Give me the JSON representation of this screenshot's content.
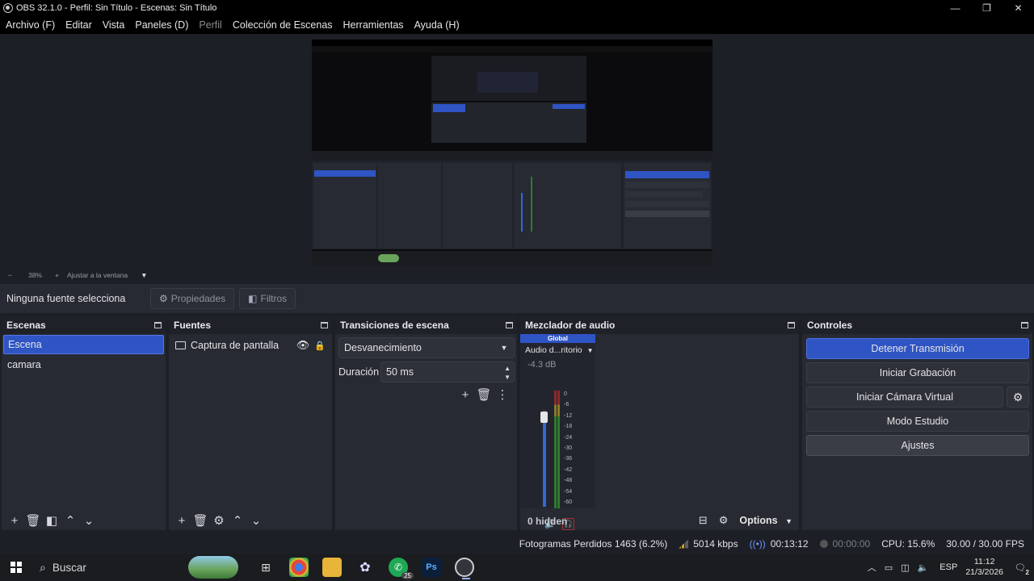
{
  "window": {
    "title": "OBS 32.1.0 - Perfil: Sin Título - Escenas: Sin Título",
    "minimize": "—",
    "maximize": "❐",
    "close": "✕"
  },
  "menu": [
    "Archivo (F)",
    "Editar",
    "Vista",
    "Paneles (D)",
    "Perfil",
    "Colección de Escenas",
    "Herramientas",
    "Ayuda (H)"
  ],
  "zoom": {
    "minus": "−",
    "value": "38%",
    "plus": "+",
    "fit": "Ajustar a la ventana",
    "dropdown": "▼"
  },
  "source_toolbar": {
    "no_selection": "Ninguna fuente selecciona",
    "properties": "Propiedades",
    "filters": "Filtros"
  },
  "scenes": {
    "title": "Escenas",
    "items": [
      "Escena",
      "camara"
    ]
  },
  "sources": {
    "title": "Fuentes",
    "items": [
      {
        "name": "Captura de pantalla",
        "icon": "monitor-icon"
      }
    ]
  },
  "transitions": {
    "title": "Transiciones de escena",
    "selected": "Desvanecimiento",
    "duration_label": "Duración",
    "duration_value": "50 ms"
  },
  "audio_mixer": {
    "title": "Mezclador de audio",
    "global_label": "Global",
    "channel_name": "Audio d...ritorio",
    "db": "-4.3 dB",
    "ticks": [
      "0",
      "-6",
      "-12",
      "-18",
      "-24",
      "-30",
      "-36",
      "-42",
      "-48",
      "-54",
      "-60"
    ],
    "hidden": "0 hidden",
    "options": "Options",
    "volume_level": 0.9
  },
  "controls": {
    "title": "Controles",
    "stop_stream": "Detener Transmisión",
    "start_record": "Iniciar Grabación",
    "start_virtual_cam": "Iniciar Cámara Virtual",
    "studio_mode": "Modo Estudio",
    "settings": "Ajustes"
  },
  "status": {
    "dropped_frames": "Fotogramas Perdidos 1463 (6.2%)",
    "bitrate": "5014 kbps",
    "stream_time": "00:13:12",
    "record_time": "00:00:00",
    "cpu": "CPU: 15.6%",
    "fps": "30.00 / 30.00 FPS"
  },
  "taskbar": {
    "search": "Buscar",
    "whatsapp_badge": "25",
    "language": "ESP",
    "time": "11:12",
    "date": "21/3/2026",
    "notifications": "2"
  },
  "colors": {
    "accent": "#2f54c4",
    "panel": "#272a33",
    "background": "#1d1f26"
  }
}
